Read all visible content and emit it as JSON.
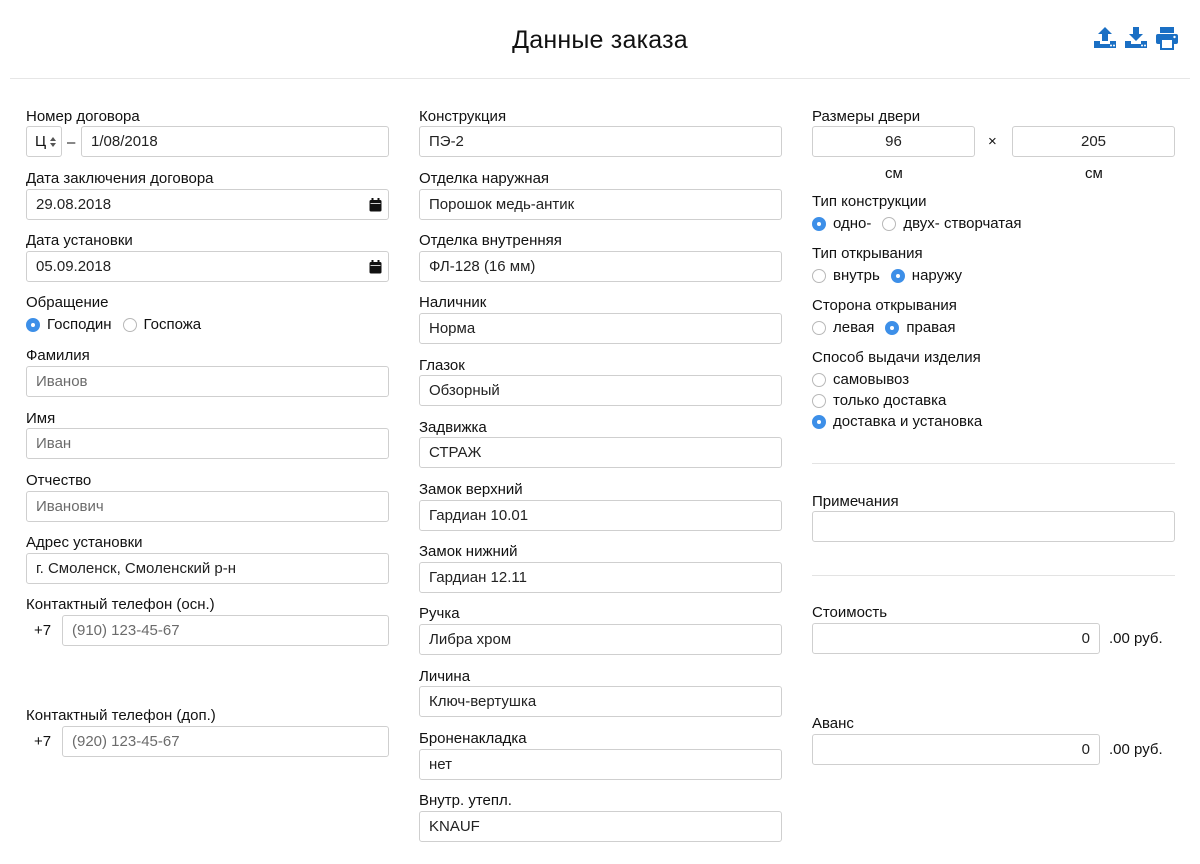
{
  "header": {
    "title": "Данные заказа",
    "icons": [
      "upload-icon",
      "download-icon",
      "print-icon"
    ]
  },
  "left": {
    "contract_number": {
      "label": "Номер договора",
      "prefix": "Ц",
      "dash": "–",
      "value": "1/08/2018"
    },
    "contract_date": {
      "label": "Дата заключения договора",
      "value": "29.08.2018"
    },
    "install_date": {
      "label": "Дата установки",
      "value": "05.09.2018"
    },
    "salutation": {
      "label": "Обращение",
      "options": [
        "Господин",
        "Госпожа"
      ],
      "selected": "Господин"
    },
    "last_name": {
      "label": "Фамилия",
      "placeholder": "Иванов"
    },
    "first_name": {
      "label": "Имя",
      "placeholder": "Иван"
    },
    "patronymic": {
      "label": "Отчество",
      "placeholder": "Иванович"
    },
    "address": {
      "label": "Адрес установки",
      "value": "г. Смоленск, Смоленский р-н"
    },
    "phone_main": {
      "label": "Контактный телефон (осн.)",
      "code": "+7",
      "placeholder": "(910) 123-45-67"
    },
    "phone_extra": {
      "label": "Контактный телефон (доп.)",
      "code": "+7",
      "placeholder": "(920) 123-45-67"
    }
  },
  "middle": {
    "fields": [
      {
        "label": "Конструкция",
        "value": "ПЭ-2"
      },
      {
        "label": "Отделка наружная",
        "value": "Порошок медь-антик"
      },
      {
        "label": "Отделка внутренняя",
        "value": "ФЛ-128 (16 мм)"
      },
      {
        "label": "Наличник",
        "value": "Норма"
      },
      {
        "label": "Глазок",
        "value": "Обзорный"
      },
      {
        "label": "Задвижка",
        "value": "СТРАЖ"
      },
      {
        "label": "Замок верхний",
        "value": "Гардиан 10.01"
      },
      {
        "label": "Замок нижний",
        "value": "Гардиан 12.11"
      },
      {
        "label": "Ручка",
        "value": "Либра хром"
      },
      {
        "label": "Личина",
        "value": "Ключ-вертушка"
      },
      {
        "label": "Броненакладка",
        "value": "нет"
      },
      {
        "label": "Внутр. утепл.",
        "value": "KNAUF"
      }
    ]
  },
  "right": {
    "door_size": {
      "label": "Размеры двери",
      "width": "96",
      "height": "205",
      "times": "×",
      "unit": "см"
    },
    "construction_type": {
      "label": "Тип конструкции",
      "options": [
        "одно-",
        "двух- створчатая"
      ],
      "selected": "одно-"
    },
    "opening_type": {
      "label": "Тип открывания",
      "options": [
        "внутрь",
        "наружу"
      ],
      "selected": "наружу"
    },
    "opening_side": {
      "label": "Сторона открывания",
      "options": [
        "левая",
        "правая"
      ],
      "selected": "правая"
    },
    "delivery": {
      "label": "Способ выдачи изделия",
      "options": [
        "самовывоз",
        "только доставка",
        "доставка и установка"
      ],
      "selected": "доставка и установка"
    },
    "notes": {
      "label": "Примечания",
      "value": ""
    },
    "cost": {
      "label": "Стоимость",
      "value": "0",
      "suffix": ".00 руб."
    },
    "advance": {
      "label": "Аванс",
      "value": "0",
      "suffix": ".00 руб."
    }
  },
  "colors": {
    "accent": "#3d8fe8",
    "icon_blue": "#1a6fc4",
    "border": "#cfcfcf"
  }
}
